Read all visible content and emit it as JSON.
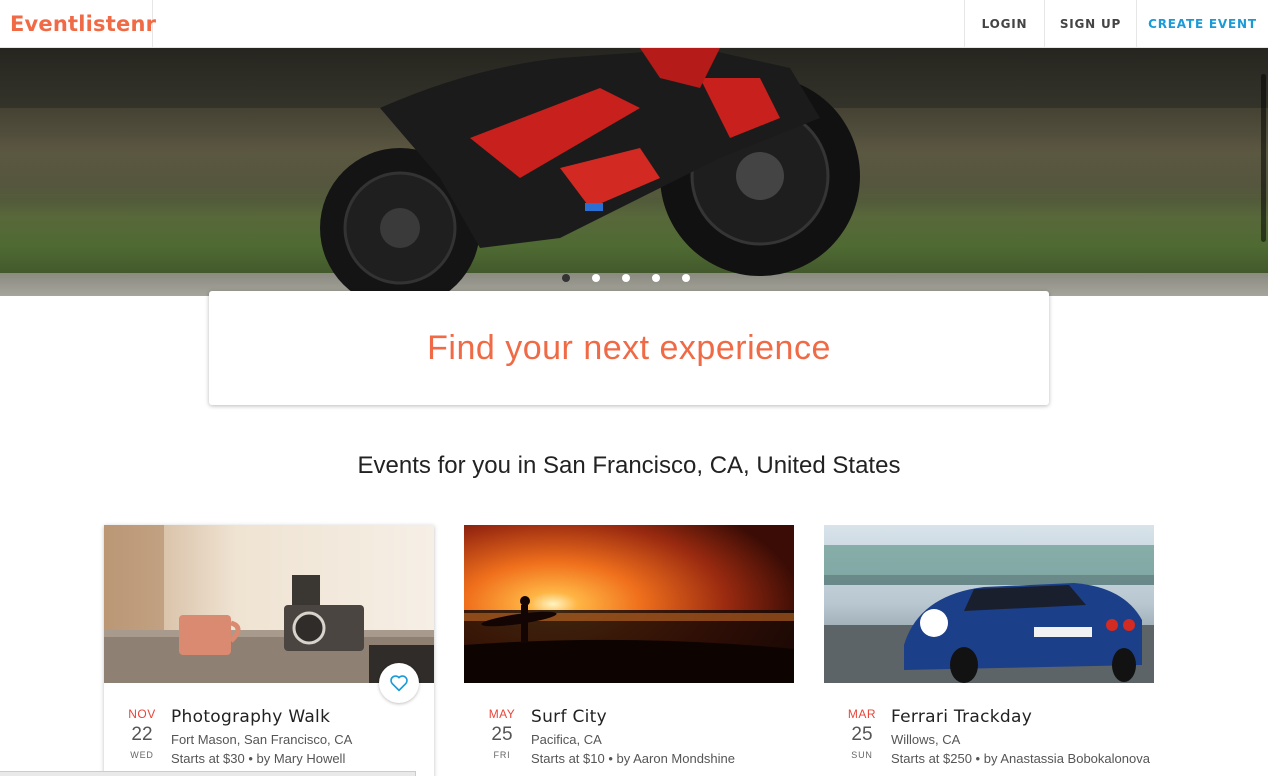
{
  "nav": {
    "brand": "Eventlistenr",
    "login": "LOGIN",
    "signup": "SIGN UP",
    "create_event": "CREATE EVENT"
  },
  "hero": {
    "slides": 5,
    "active_slide": 1
  },
  "search": {
    "placeholder": "Find your next experience"
  },
  "section": {
    "title": "Events for you in San Francisco, CA, United States"
  },
  "events": [
    {
      "month": "NOV",
      "day": "22",
      "weekday": "WED",
      "title": "Photography Walk",
      "location": "Fort Mason, San Francisco, CA",
      "price_by": "Starts at $30 • by Mary Howell"
    },
    {
      "month": "MAY",
      "day": "25",
      "weekday": "FRI",
      "title": "Surf City",
      "location": "Pacifica, CA",
      "price_by": "Starts at $10 • by Aaron Mondshine"
    },
    {
      "month": "MAR",
      "day": "25",
      "weekday": "SUN",
      "title": "Ferrari Trackday",
      "location": "Willows, CA",
      "price_by": "Starts at $250 • by Anastassia Bobokalonova"
    }
  ],
  "colors": {
    "brand": "#f06a45",
    "link": "#1a9bd7",
    "date_month": "#e8463a"
  },
  "icons": {
    "favorite": "heart-outline-icon"
  }
}
